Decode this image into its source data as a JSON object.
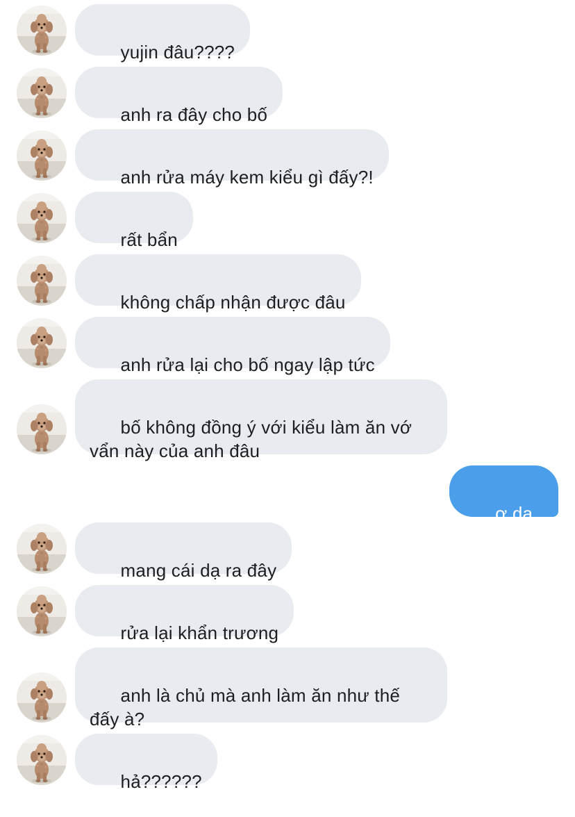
{
  "conversation": {
    "messages": [
      {
        "sender": "other",
        "text": "yujin đâu????"
      },
      {
        "sender": "other",
        "text": "anh ra đây cho bố"
      },
      {
        "sender": "other",
        "text": "anh rửa máy kem kiểu gì đấy?!"
      },
      {
        "sender": "other",
        "text": "rất bẩn"
      },
      {
        "sender": "other",
        "text": "không chấp nhận được đâu"
      },
      {
        "sender": "other",
        "text": "anh rửa lại cho bố ngay lập tức"
      },
      {
        "sender": "other",
        "text": "bố không đồng ý với kiểu làm ăn vớ\nvẩn này của anh đâu"
      },
      {
        "sender": "me",
        "text": "ơ dạ.."
      },
      {
        "sender": "other",
        "text": "mang cái dạ ra đây"
      },
      {
        "sender": "other",
        "text": "rửa lại khẩn trương"
      },
      {
        "sender": "other",
        "text": "anh là chủ mà anh làm ăn như thế\nđấy à?"
      },
      {
        "sender": "other",
        "text": "hả??????"
      }
    ]
  },
  "avatar": {
    "icon": "poodle-avatar-icon"
  },
  "colors": {
    "incoming_bubble": "#e8ebf0",
    "outgoing_bubble": "#4a9eea",
    "incoming_text": "#1c1e21",
    "outgoing_text": "#ffffff"
  }
}
